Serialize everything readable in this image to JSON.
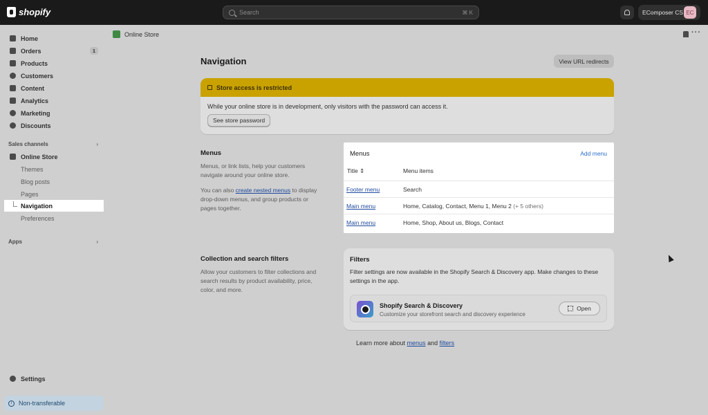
{
  "topbar": {
    "brand": "shopify",
    "search_placeholder": "Search",
    "search_shortcut": "⌘ K",
    "store_name": "EComposer CS",
    "avatar_initials": "EC"
  },
  "sidebar": {
    "items": [
      {
        "label": "Home",
        "icon": "home-icon"
      },
      {
        "label": "Orders",
        "icon": "orders-icon",
        "badge": "1"
      },
      {
        "label": "Products",
        "icon": "tag-icon"
      },
      {
        "label": "Customers",
        "icon": "person-icon"
      },
      {
        "label": "Content",
        "icon": "content-icon"
      },
      {
        "label": "Analytics",
        "icon": "bar-chart-icon"
      },
      {
        "label": "Marketing",
        "icon": "target-icon"
      },
      {
        "label": "Discounts",
        "icon": "discount-icon"
      }
    ],
    "sales_channels_label": "Sales channels",
    "online_store_label": "Online Store",
    "sub_items": [
      "Themes",
      "Blog posts",
      "Pages",
      "Navigation",
      "Preferences"
    ],
    "apps_label": "Apps",
    "settings_label": "Settings",
    "non_transferable_label": "Non-transferable"
  },
  "main": {
    "breadcrumb": "Online Store",
    "title": "Navigation",
    "view_redirects_label": "View URL redirects",
    "banner": {
      "title": "Store access is restricted",
      "text": "While your online store is in development, only visitors with the password can access it.",
      "button_label": "See store password"
    },
    "menus_section": {
      "title": "Menus",
      "desc1": "Menus, or link lists, help your customers navigate around your online store.",
      "desc2_pre": "You can also ",
      "desc2_link": "create nested menus",
      "desc2_post": " to display drop-down menus, and group products or pages together."
    },
    "menus_card": {
      "title": "Menus",
      "add_label": "Add menu",
      "col_title": "Title",
      "col_items": "Menu items",
      "rows": [
        {
          "title": "Footer menu",
          "items": "Search",
          "extra": ""
        },
        {
          "title": "Main menu",
          "items": "Home, Catalog, Contact, Menu 1, Menu 2",
          "extra": "(+ 5 others)"
        },
        {
          "title": "Main menu",
          "items": "Home, Shop, About us, Blogs, Contact",
          "extra": ""
        }
      ]
    },
    "filters_section": {
      "title": "Collection and search filters",
      "desc": "Allow your customers to filter collections and search results by product availability, price, color, and more."
    },
    "filters_card": {
      "title": "Filters",
      "desc": "Filter settings are now available in the Shopify Search & Discovery app. Make changes to these settings in the app.",
      "app_name": "Shopify Search & Discovery",
      "app_desc": "Customize your storefront search and discovery experience",
      "open_label": "Open"
    },
    "learn_more": {
      "pre": "Learn more about ",
      "link1": "menus",
      "mid": " and ",
      "link2": "filters"
    }
  }
}
